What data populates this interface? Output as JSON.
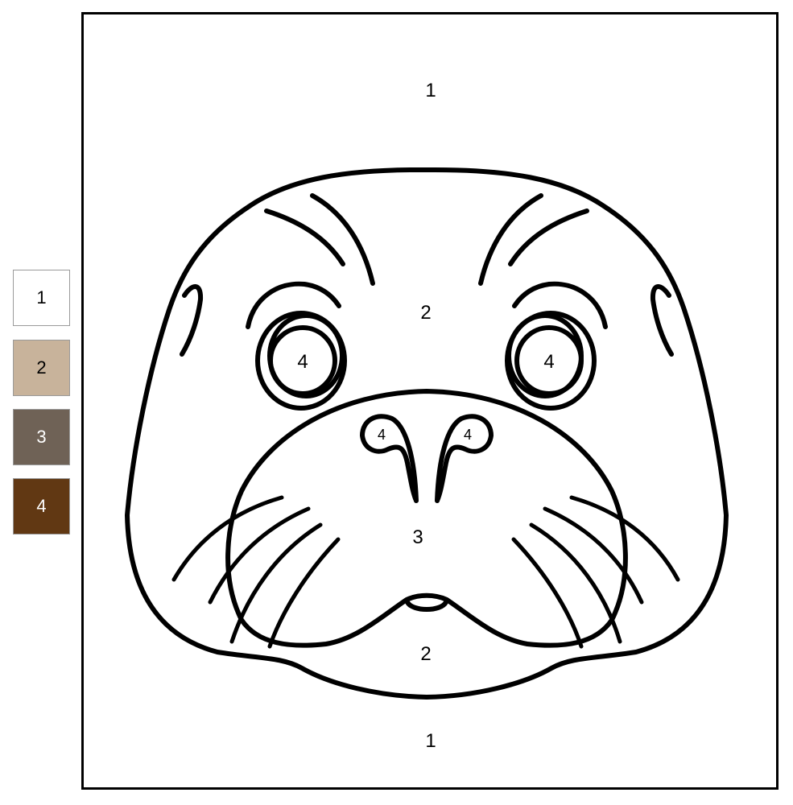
{
  "palette": [
    {
      "number": "1",
      "color": "#ffffff",
      "text_color": "#000000"
    },
    {
      "number": "2",
      "color": "#c8b39b",
      "text_color": "#000000"
    },
    {
      "number": "3",
      "color": "#6f6256",
      "text_color": "#ffffff"
    },
    {
      "number": "4",
      "color": "#613813",
      "text_color": "#ffffff"
    }
  ],
  "regions": {
    "background_top": "1",
    "background_bottom": "1",
    "face_forehead": "2",
    "face_chin": "2",
    "muzzle": "3",
    "left_eye": "4",
    "right_eye": "4",
    "left_nostril": "4",
    "right_nostril": "4"
  }
}
